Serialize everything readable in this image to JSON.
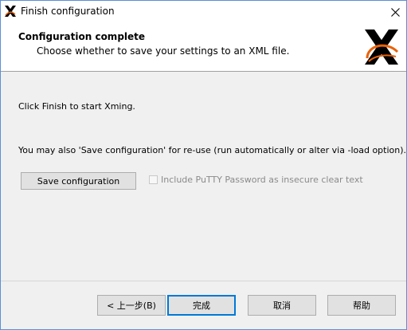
{
  "window": {
    "title": "Finish configuration",
    "accent_color": "#0078d7"
  },
  "header": {
    "title": "Configuration complete",
    "subtitle": "Choose whether to save your settings to an XML file.",
    "logo": "xming-x-logo"
  },
  "body": {
    "start_text": "Click Finish to start Xming.",
    "save_hint": "You may also 'Save configuration' for re-use (run automatically or alter via -load option).",
    "save_button_label": "Save configuration",
    "include_putty_checkbox": {
      "label": "Include PuTTY Password as insecure clear text",
      "checked": false,
      "enabled": false
    }
  },
  "footer": {
    "back_label": "< 上一步(B)",
    "finish_label": "完成",
    "cancel_label": "取消",
    "help_label": "帮助"
  }
}
